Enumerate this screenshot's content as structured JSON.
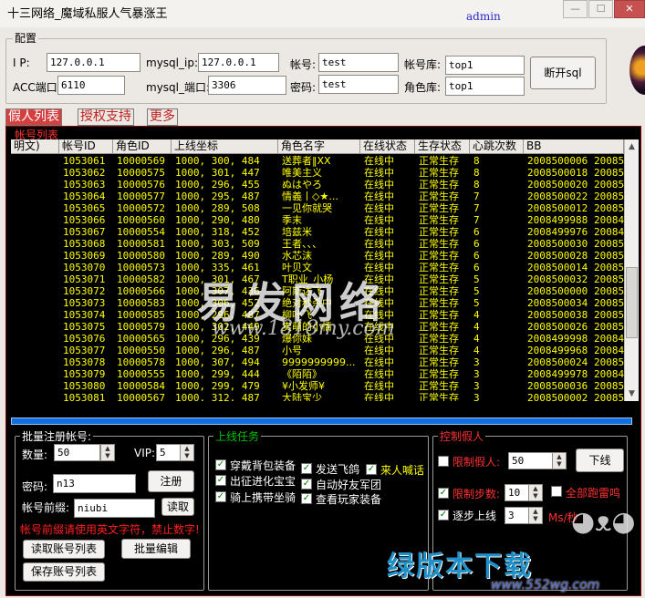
{
  "window": {
    "title": "十三网络_魔域私服人气暴涨王",
    "user": "admin",
    "controls": [
      "—",
      "☐",
      "✕"
    ]
  },
  "config": {
    "legend": "配置",
    "ip_label": "I  P:",
    "ip": "127.0.0.1",
    "mysql_ip_label": "mysql_ip:",
    "mysql_ip": "127.0.0.1",
    "acc_port_label": "ACC端口:",
    "acc_port": "6110",
    "mysql_port_label": "mysql_端口:",
    "mysql_port": "3306",
    "account_label": "帐号:",
    "account": "test",
    "password_label": "密码:",
    "password": "test",
    "account_db_label": "帐号库:",
    "account_db": "top1",
    "role_db_label": "角色库:",
    "role_db": "top1",
    "disconnect_label": "断开sql"
  },
  "tabs": [
    "假人列表",
    "授权支持",
    "更多"
  ],
  "list": {
    "title": "帐号列表",
    "columns": [
      "明文)",
      "帐号ID",
      "角色ID",
      "上线坐标",
      "角色名字",
      "在线状态",
      "生存状态",
      "心跳次数",
      "BB"
    ],
    "rows": [
      [
        "1053061",
        "10000569",
        "1000, 300, 484",
        "送葬者‖XX",
        "在线中",
        "正常生存",
        "8",
        "2008500006",
        "200850"
      ],
      [
        "1053062",
        "10000575",
        "1000, 301, 447",
        "唯美主义",
        "在线中",
        "正常生存",
        "8",
        "2008500018",
        "200850"
      ],
      [
        "1053063",
        "10000576",
        "1000, 296, 455",
        "ぬはやろ",
        "在线中",
        "正常生存",
        "8",
        "2008500020",
        "200850"
      ],
      [
        "1053064",
        "10000577",
        "1000, 295, 487",
        "情義丨◇★...",
        "在线中",
        "正常生存",
        "7",
        "2008500022",
        "200850"
      ],
      [
        "1053065",
        "10000572",
        "1000, 289, 508",
        "一见你就哭",
        "在线中",
        "正常生存",
        "7",
        "2008500012",
        "200850"
      ],
      [
        "1053066",
        "10000560",
        "1000, 290, 480",
        "季末",
        "在线中",
        "正常生存",
        "7",
        "2008499988",
        "200849"
      ],
      [
        "1053067",
        "10000554",
        "1000, 318, 452",
        "培兹米",
        "在线中",
        "正常生存",
        "6",
        "2008499976",
        "200849"
      ],
      [
        "1053068",
        "10000581",
        "1000, 303, 509",
        "王者、、、",
        "在线中",
        "正常生存",
        "6",
        "2008500030",
        "200850"
      ],
      [
        "1053069",
        "10000580",
        "1000, 289, 490",
        "水芯沫",
        "在线中",
        "正常生存",
        "6",
        "2008500028",
        "200850"
      ],
      [
        "1053070",
        "10000573",
        "1000, 335, 461",
        "叶贝文",
        "在线中",
        "正常生存",
        "6",
        "2008500014",
        "200850"
      ],
      [
        "1053071",
        "10000582",
        "1000, 301, 467",
        "T职业_小杨",
        "在线中",
        "正常生存",
        "5",
        "2008500032",
        "200850"
      ],
      [
        "1053072",
        "10000566",
        "1000, 307, 436",
        "阿斯达飞",
        "在线中",
        "正常生存",
        "5",
        "2008500000",
        "200850"
      ],
      [
        "1053073",
        "10000583",
        "1000, 306, 452",
        "绝对秒杀中",
        "在线中",
        "正常生存",
        "5",
        "2008500034",
        "200850"
      ],
      [
        "1053074",
        "10000585",
        "1000, 296, 487",
        "柳叶飞",
        "在线中",
        "正常生存",
        "4",
        "2008500038",
        "200850"
      ],
      [
        "1053075",
        "10000579",
        "1000, 302, 449",
        "卖萌的小情",
        "在线中",
        "正常生存",
        "4",
        "2008500026",
        "200850"
      ],
      [
        "1053076",
        "10000565",
        "1000, 296, 439",
        "爆你妹",
        "在线中",
        "正常生存",
        "4",
        "2008499998",
        "200849"
      ],
      [
        "1053077",
        "10000550",
        "1000, 296, 487",
        "小号",
        "在线中",
        "正常生存",
        "4",
        "2008499968",
        "200849"
      ],
      [
        "1053078",
        "10000578",
        "1000, 307, 494",
        "9999999999...",
        "在线中",
        "正常生存",
        "3",
        "2008500024",
        "200850"
      ],
      [
        "1053079",
        "10000555",
        "1000, 299, 444",
        "《陌陌》",
        "在线中",
        "正常生存",
        "3",
        "2008499978",
        "200849"
      ],
      [
        "1053080",
        "10000584",
        "1000, 299, 479",
        "¥小发师¥",
        "在线中",
        "正常生存",
        "3",
        "2008500036",
        "200850"
      ],
      [
        "1053081",
        "10000567",
        "1000, 312, 487",
        "大陆宝少",
        "在线中",
        "正常生存",
        "3",
        "2008500002",
        "200850"
      ]
    ]
  },
  "scroll": {
    "up": "▲",
    "down": "▼"
  },
  "batch": {
    "legend": "批量注册帐号:",
    "count_label": "数量:",
    "count": "50",
    "vip_label": "VIP:",
    "vip": "5",
    "password_label": "密码:",
    "password": "n13",
    "register_label": "注册",
    "prefix_label": "帐号前缀:",
    "prefix": "niubi",
    "read_label": "读取",
    "warning": "帐号前缀请使用英文字符，禁止数字!",
    "read_list_label": "读取账号列表",
    "batch_edit_label": "批量编辑",
    "save_list_label": "保存账号列表"
  },
  "online_tasks": {
    "legend": "上线任务",
    "items": [
      "穿戴背包装备",
      "发送飞鸽",
      "来人喊话",
      "出征进化宝宝",
      "自动好友军团",
      "骑上携带坐骑",
      "查看玩家装备"
    ]
  },
  "control": {
    "legend": "控制假人",
    "limit_fake_label": "限制假人:",
    "limit_fake": "50",
    "offline_label": "下线",
    "limit_steps_label": "限制步数:",
    "limit_steps": "10",
    "all_run_label": "全部跑雷鸣",
    "step_online_label": "逐步上线",
    "step_online": "3",
    "unit": "Ms/秒"
  },
  "watermarks": {
    "main": "易发网络",
    "main_url": "www.1818my.com",
    "corner": "绿版本下载",
    "corner_url": "www.552wg.com"
  },
  "colors": {
    "grid_text": "#ffff00",
    "panel_bg": "#000000",
    "accent_red": "#ff3030",
    "tab_active": "#d44040",
    "progress": "#1070e0"
  }
}
